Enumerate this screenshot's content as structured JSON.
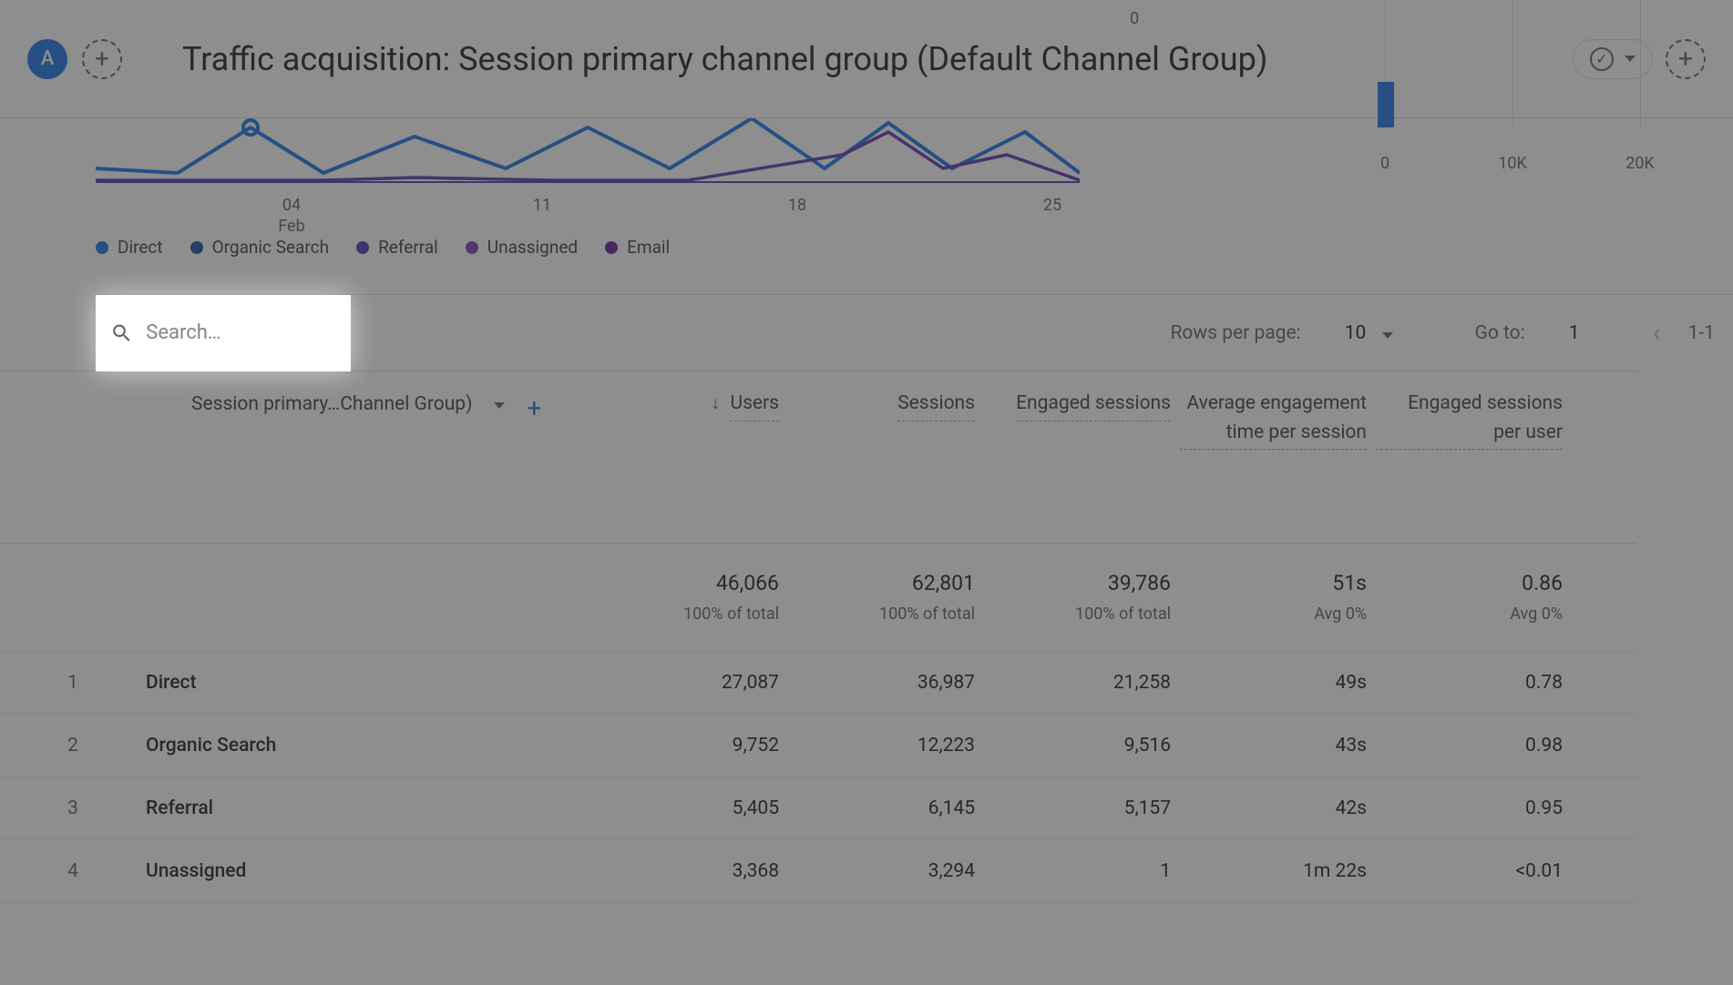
{
  "header": {
    "avatar_letter": "A",
    "title": "Traffic acquisition: Session primary channel group (Default Channel Group)"
  },
  "chart_data": {
    "line_chart": {
      "type": "line",
      "x_ticks": [
        {
          "label_top": "04",
          "label_bottom": "Feb"
        },
        {
          "label_top": "11",
          "label_bottom": ""
        },
        {
          "label_top": "18",
          "label_bottom": ""
        },
        {
          "label_top": "25",
          "label_bottom": ""
        }
      ],
      "series_colors": {
        "Direct": "#1a73e8",
        "Organic Search": "#174ea6",
        "Referral": "#4a3db8",
        "Unassigned": "#7b3fb5",
        "Email": "#6a1b9a"
      }
    },
    "bar_chart": {
      "type": "bar",
      "y_zero_label": "0",
      "x_ticks": [
        "0",
        "10K",
        "20K"
      ]
    }
  },
  "legend": [
    {
      "label": "Direct",
      "color": "#1a73e8"
    },
    {
      "label": "Organic Search",
      "color": "#174ea6"
    },
    {
      "label": "Referral",
      "color": "#4a3db8"
    },
    {
      "label": "Unassigned",
      "color": "#7b3fb5"
    },
    {
      "label": "Email",
      "color": "#6a1b9a"
    }
  ],
  "search": {
    "placeholder": "Search…"
  },
  "pagination": {
    "rows_label": "Rows per page:",
    "rows_value": "10",
    "goto_label": "Go to:",
    "goto_value": "1",
    "range": "1-1"
  },
  "table": {
    "dimension_label": "Session primary…Channel Group)",
    "metric_headers": [
      "Users",
      "Sessions",
      "Engaged sessions",
      "Average engagement time per session",
      "Engaged sessions per user"
    ],
    "totals": {
      "values": [
        "46,066",
        "62,801",
        "39,786",
        "51s",
        "0.86"
      ],
      "subs": [
        "100% of total",
        "100% of total",
        "100% of total",
        "Avg 0%",
        "Avg 0%"
      ]
    },
    "rows": [
      {
        "idx": "1",
        "dim": "Direct",
        "vals": [
          "27,087",
          "36,987",
          "21,258",
          "49s",
          "0.78"
        ]
      },
      {
        "idx": "2",
        "dim": "Organic Search",
        "vals": [
          "9,752",
          "12,223",
          "9,516",
          "43s",
          "0.98"
        ]
      },
      {
        "idx": "3",
        "dim": "Referral",
        "vals": [
          "5,405",
          "6,145",
          "5,157",
          "42s",
          "0.95"
        ]
      },
      {
        "idx": "4",
        "dim": "Unassigned",
        "vals": [
          "3,368",
          "3,294",
          "1",
          "1m 22s",
          "<0.01"
        ]
      }
    ]
  }
}
